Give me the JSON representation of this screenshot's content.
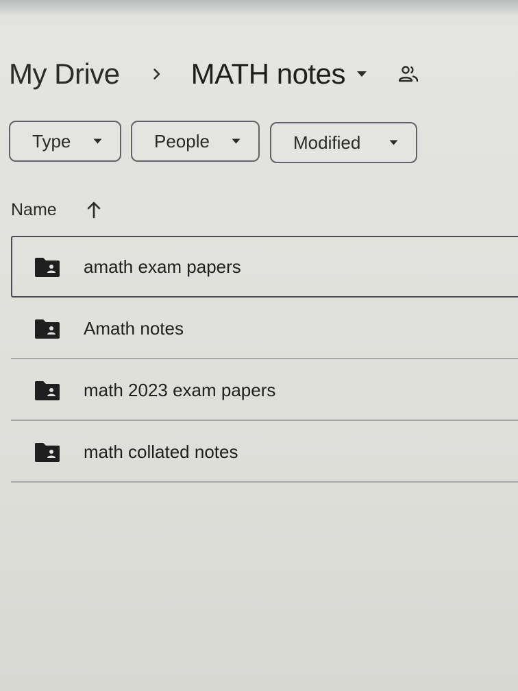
{
  "breadcrumb": {
    "root": "My Drive",
    "current": "MATH notes",
    "separator_icon": "chevron-right-icon",
    "dropdown_icon": "caret-down-icon",
    "shared_icon": "people-icon"
  },
  "filters": {
    "type": "Type",
    "people": "People",
    "modified": "Modified"
  },
  "columns": {
    "name": "Name",
    "sort_direction": "ascending"
  },
  "files": [
    {
      "name": "amath exam papers",
      "type": "shared-folder",
      "selected": true
    },
    {
      "name": "Amath notes",
      "type": "shared-folder",
      "selected": false
    },
    {
      "name": "math 2023 exam papers",
      "type": "shared-folder",
      "selected": false
    },
    {
      "name": "math collated notes",
      "type": "shared-folder",
      "selected": false
    }
  ],
  "colors": {
    "text": "#1f1f1f",
    "icon": "#1f1f1f",
    "chip_border": "#5f6368",
    "divider": "#a6a7a6",
    "background": "#e2e2de"
  }
}
